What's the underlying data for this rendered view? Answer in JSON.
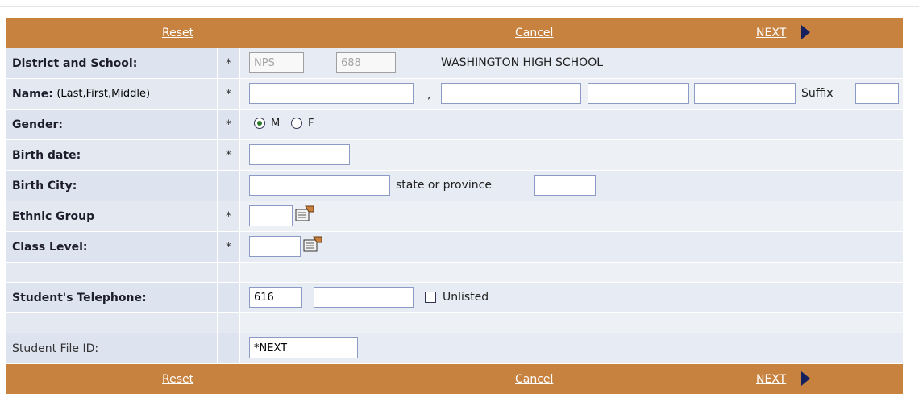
{
  "nav": {
    "reset": "Reset",
    "cancel": "Cancel",
    "next": "NEXT"
  },
  "fields": {
    "district_school": {
      "label": "District and School:",
      "required": "*",
      "district": "NPS",
      "school": "688",
      "school_name": "WASHINGTON HIGH SCHOOL"
    },
    "name": {
      "label": "Name:",
      "sublabel": "(Last,First,Middle)",
      "required": "*",
      "comma": ",",
      "suffix_label": "Suffix"
    },
    "gender": {
      "label": "Gender:",
      "required": "*",
      "opt_m": "M",
      "opt_f": "F",
      "selected": "M"
    },
    "birth_date": {
      "label": "Birth date:",
      "required": "*"
    },
    "birth_city": {
      "label": "Birth City:",
      "state_label": "state or province"
    },
    "ethnic_group": {
      "label": "Ethnic Group",
      "required": "*"
    },
    "class_level": {
      "label": "Class Level:",
      "required": "*"
    },
    "telephone": {
      "label": "Student's Telephone:",
      "area_code": "616",
      "unlisted_label": "Unlisted"
    },
    "file_id": {
      "label": "Student File ID:",
      "value": "*NEXT"
    }
  },
  "colors": {
    "bar": "#c8823f",
    "row_bg": "#dde3ef",
    "arrow": "#15205e"
  },
  "icons": {
    "picker": "lookup-picker-icon",
    "next_arrow": "triangle-right-icon"
  }
}
